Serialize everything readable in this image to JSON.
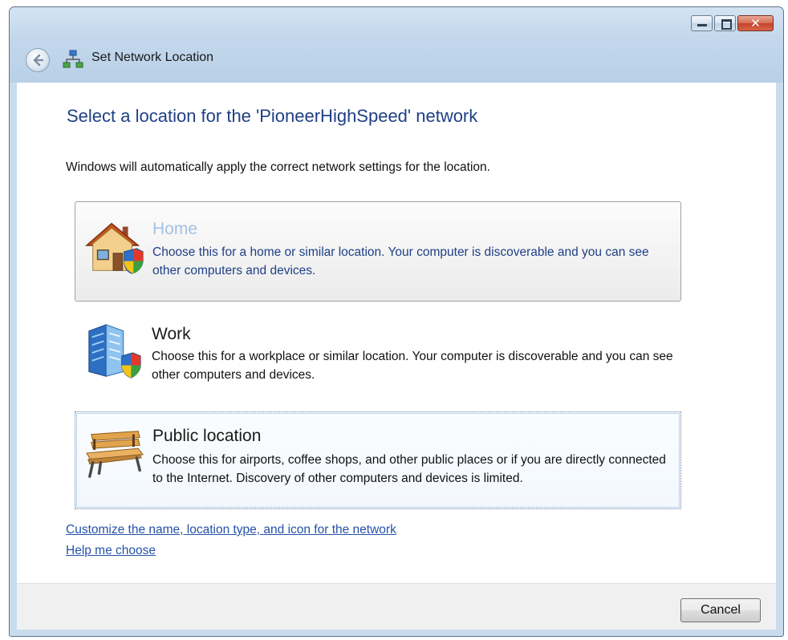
{
  "window": {
    "title": "Set Network Location",
    "icons": {
      "back": "back-arrow-icon",
      "title": "network-icon",
      "minimize": "minimize-icon",
      "maximize": "maximize-icon",
      "close": "close-icon"
    }
  },
  "content": {
    "heading": "Select a location for the 'PioneerHighSpeed' network",
    "description": "Windows will automatically apply the correct network settings for the location.",
    "options": [
      {
        "title": "Home",
        "description": "Choose this for a home or similar location. Your computer is discoverable and you can see other computers and devices.",
        "icon": "home-icon",
        "state": "hover"
      },
      {
        "title": "Work",
        "description": "Choose this for a workplace or similar location. Your computer is discoverable and you can see other computers and devices.",
        "icon": "work-building-icon",
        "state": "normal"
      },
      {
        "title": "Public location",
        "description": "Choose this for airports, coffee shops, and other public places or if you are directly connected to the Internet. Discovery of other computers and devices is limited.",
        "icon": "park-bench-icon",
        "state": "focused"
      }
    ],
    "links": {
      "customize": "Customize the name, location type, and icon for the network",
      "help": "Help me choose"
    }
  },
  "footer": {
    "cancel_label": "Cancel"
  },
  "colors": {
    "heading": "#1f3f86",
    "link": "#2451a8",
    "hover_title": "#a4c0e2",
    "titlebar": "#c2d7eb"
  }
}
